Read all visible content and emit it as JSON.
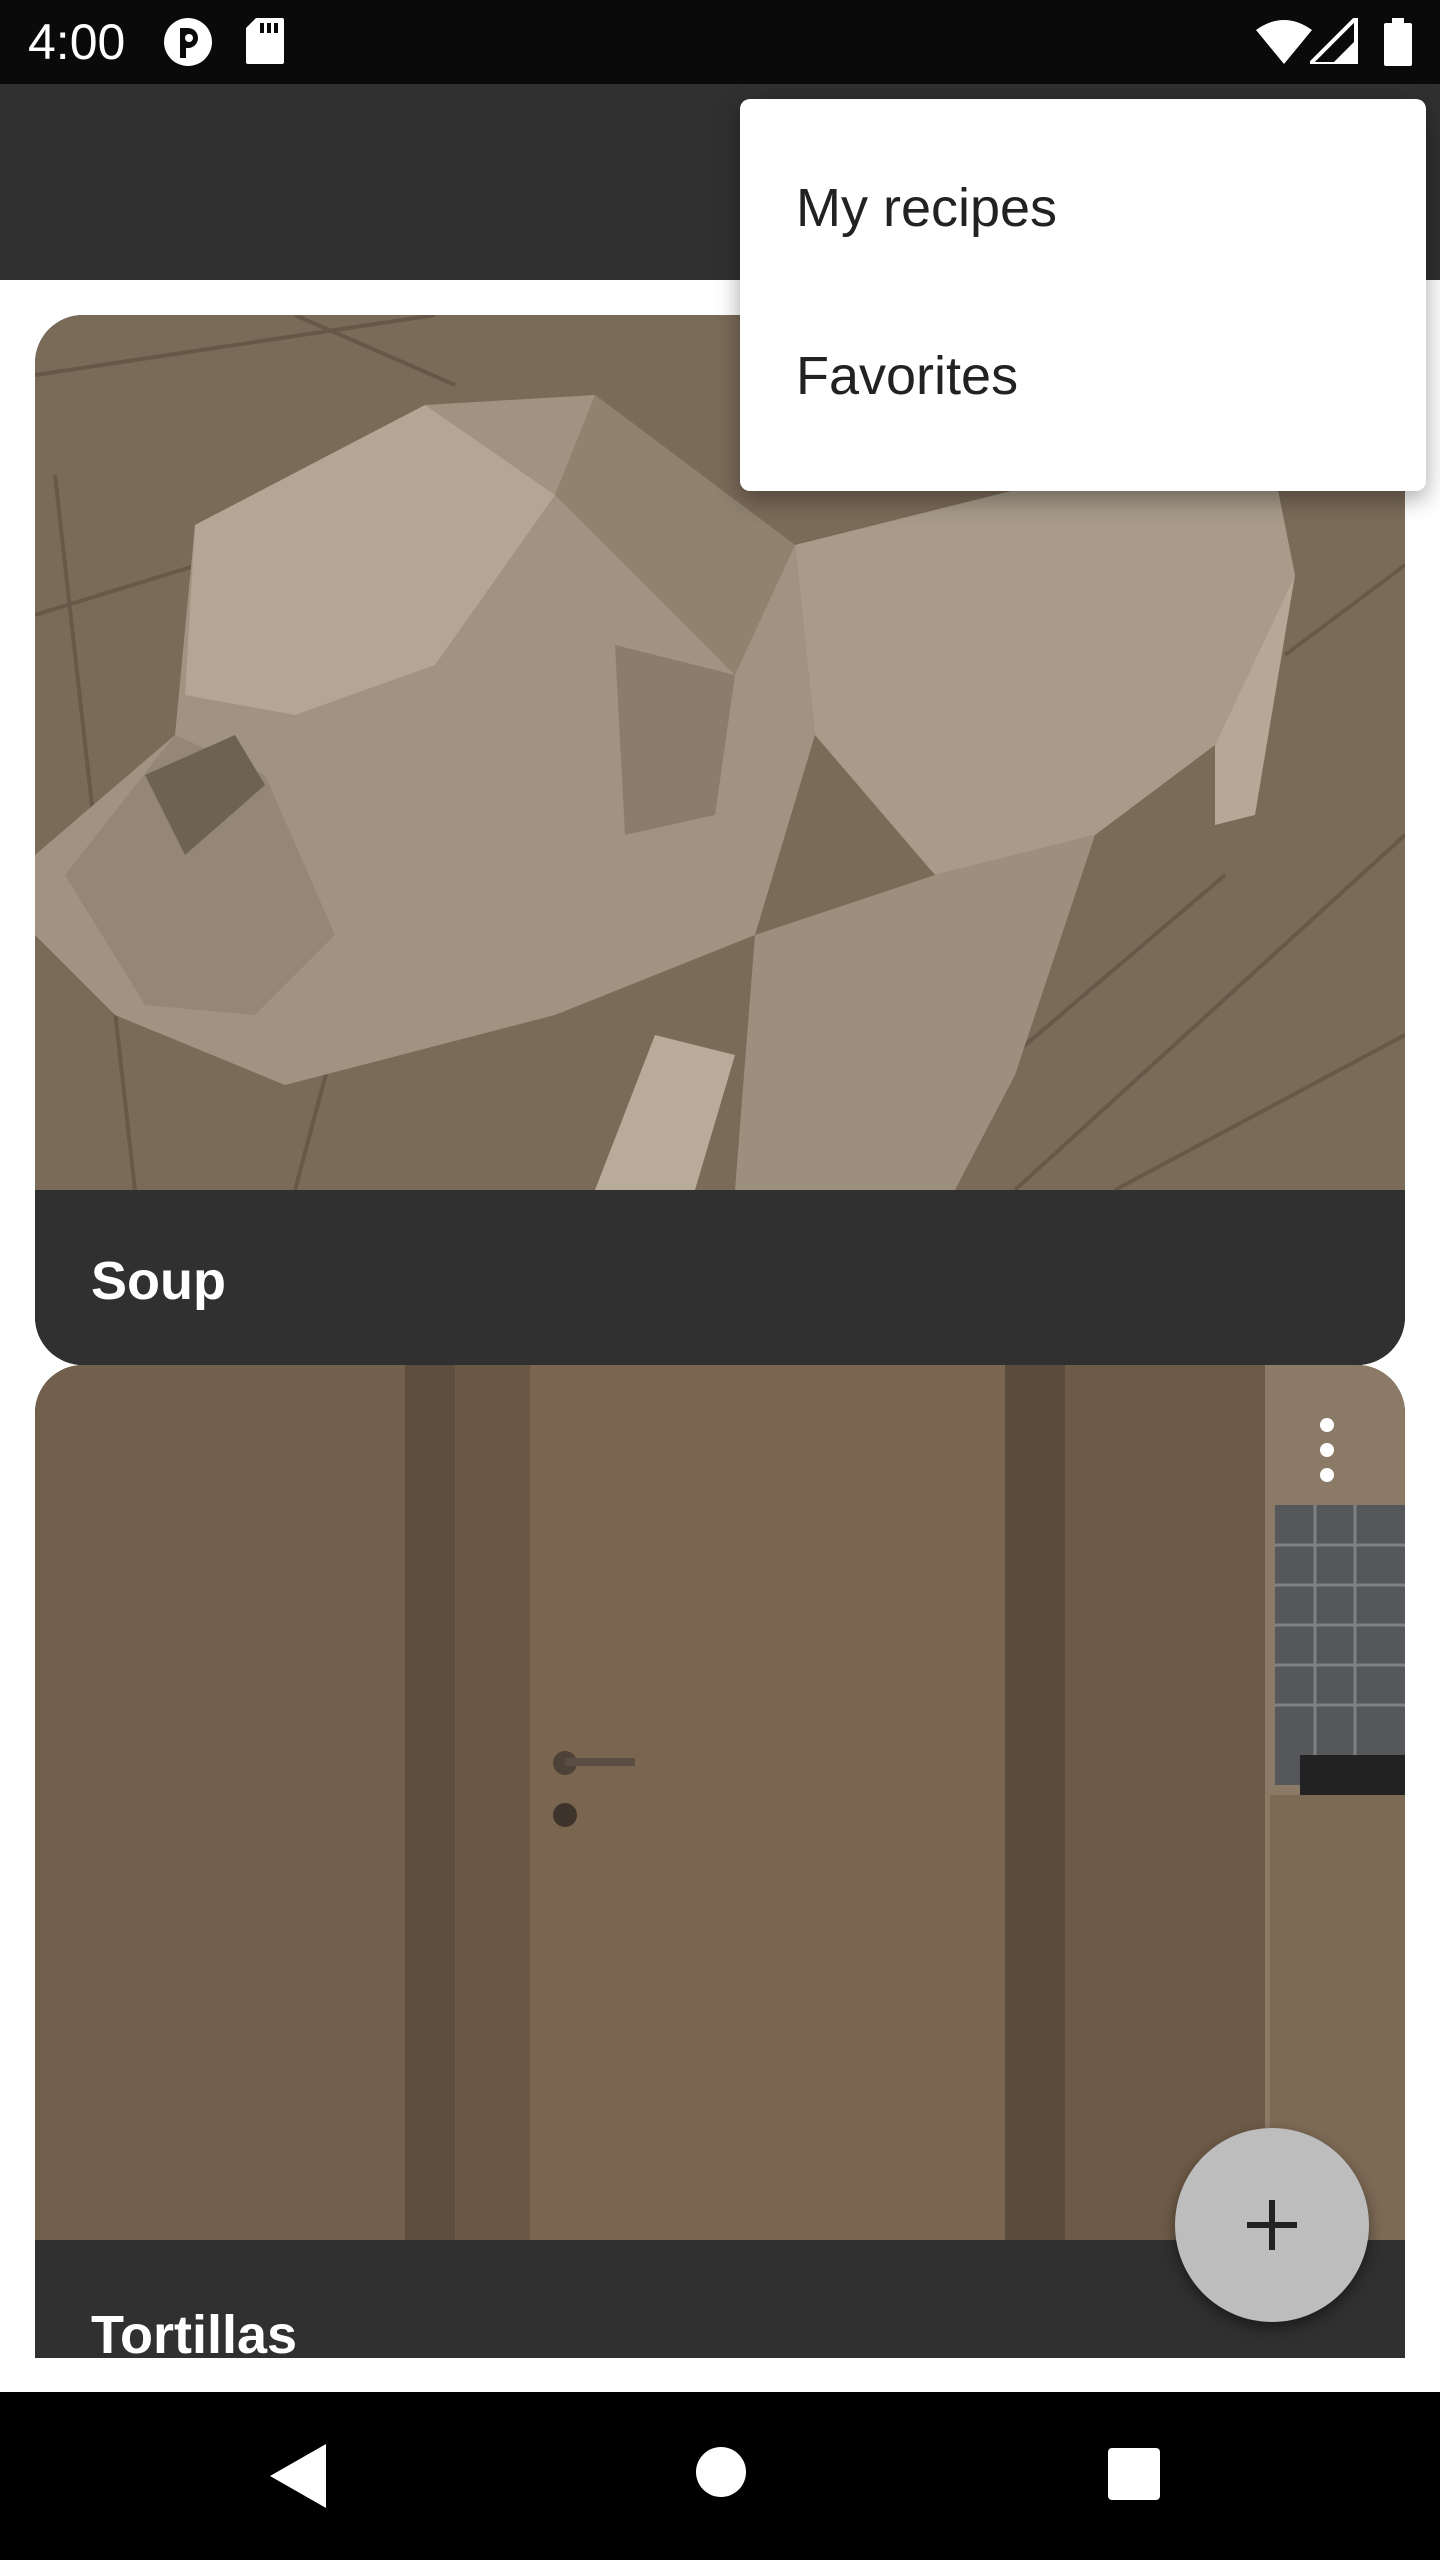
{
  "status_bar": {
    "time": "4:00",
    "icons": [
      "app-notification-icon",
      "sd-card-icon",
      "wifi-icon",
      "cell-signal-icon",
      "battery-icon"
    ]
  },
  "overflow_menu": {
    "items": [
      {
        "label": "My recipes"
      },
      {
        "label": "Favorites"
      }
    ]
  },
  "recipes": [
    {
      "title": "Soup",
      "image": "low-poly dog on wooden floor"
    },
    {
      "title": "Tortillas",
      "image": "wooden door in kitchen"
    }
  ],
  "fab": {
    "icon": "plus-icon"
  },
  "nav_bar": {
    "icons": [
      "back-icon",
      "home-icon",
      "recents-icon"
    ]
  },
  "colors": {
    "app_bar": "#303030",
    "card_footer": "#303030",
    "fab": "#bdbdbd",
    "menu_bg": "#ffffff",
    "status_bar": "#0a0a0a",
    "nav_bar": "#000000"
  }
}
